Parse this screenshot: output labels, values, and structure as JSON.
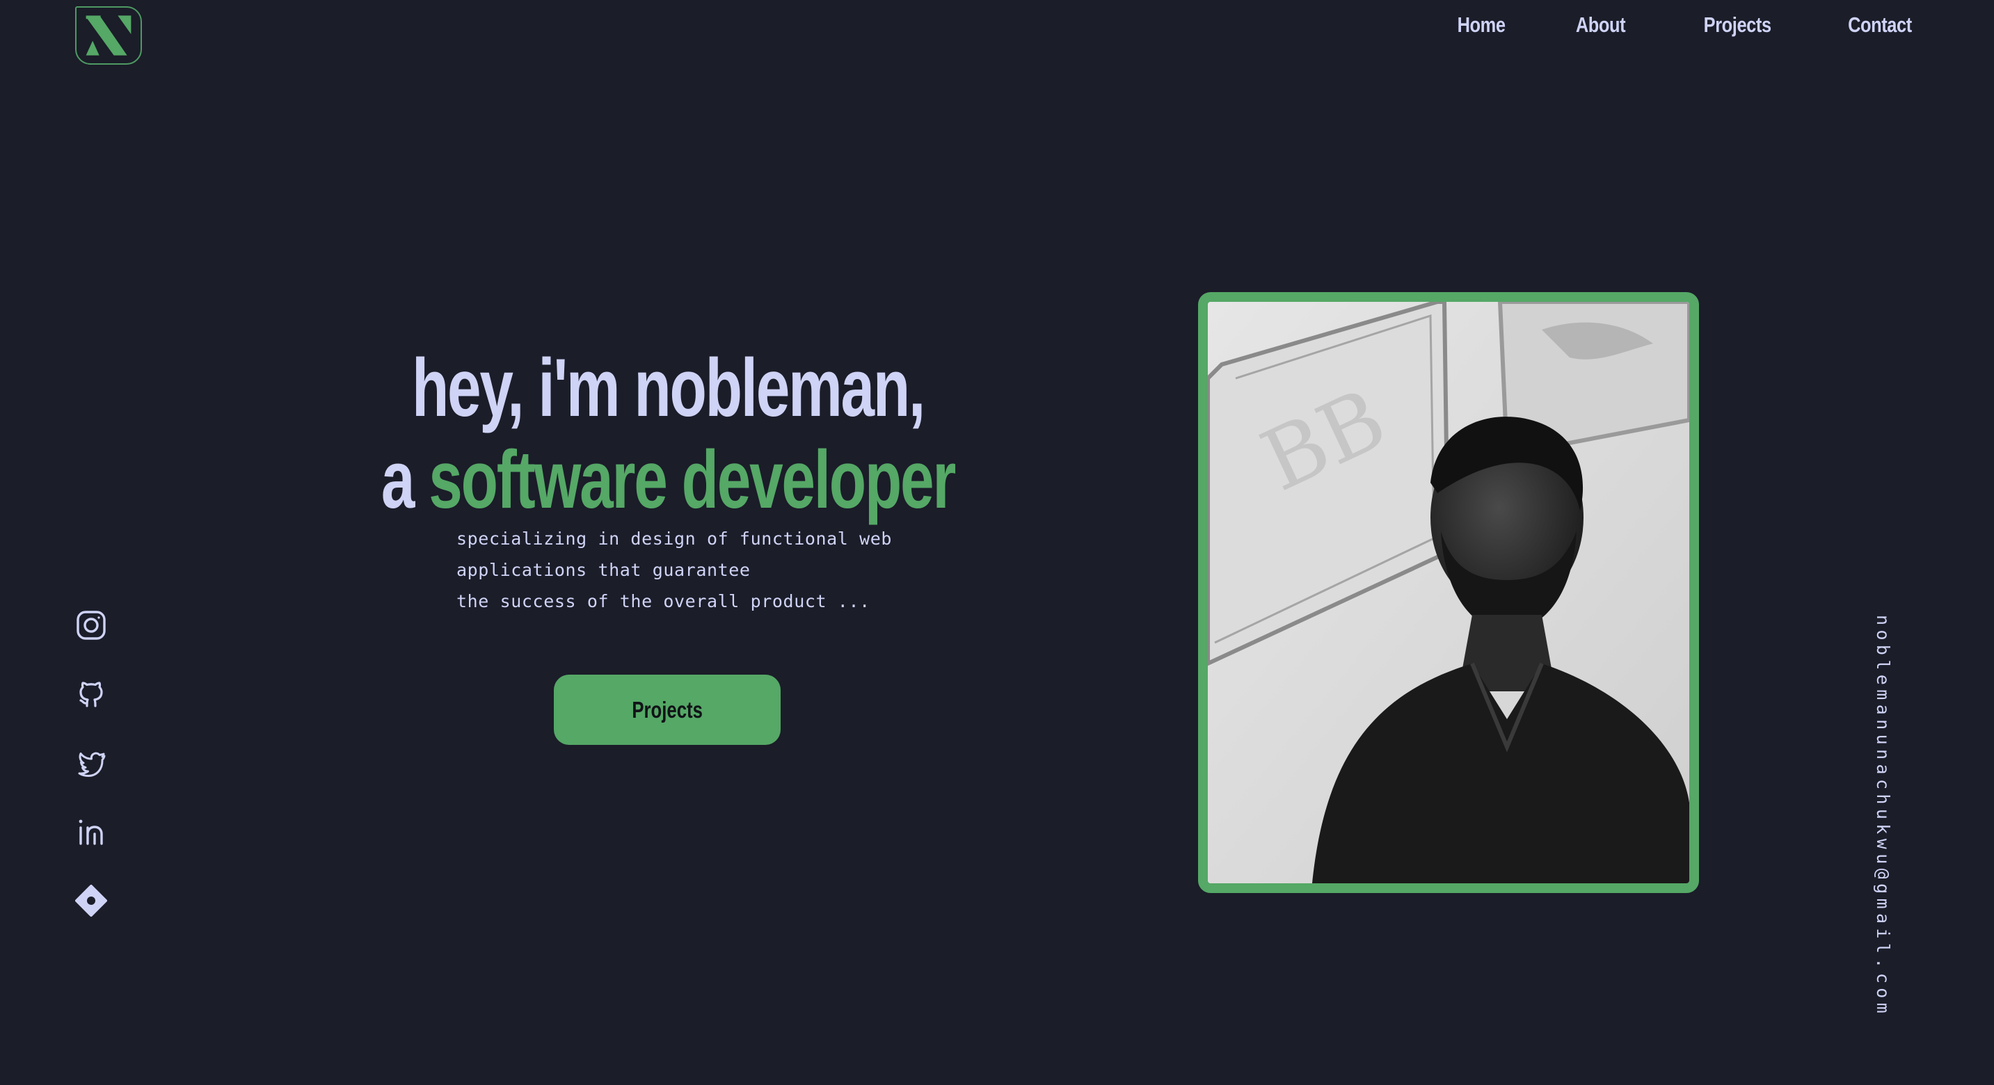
{
  "logo": {
    "letter": "N",
    "icon": "logo-n-icon",
    "color": "#55a866"
  },
  "nav": {
    "items": [
      {
        "label": "Home"
      },
      {
        "label": "About"
      },
      {
        "label": "Projects"
      },
      {
        "label": "Contact"
      }
    ]
  },
  "hero": {
    "line1": "hey, i'm nobleman,",
    "line2_prefix": "a ",
    "line2_accent": "software developer",
    "subtitle": "specializing in design of functional web\napplications that guarantee\nthe success of the overall product ...",
    "cta_label": "Projects"
  },
  "socials": [
    {
      "name": "instagram-icon"
    },
    {
      "name": "github-icon"
    },
    {
      "name": "twitter-icon"
    },
    {
      "name": "linkedin-icon"
    },
    {
      "name": "diamond-icon"
    }
  ],
  "photo": {
    "alt": "portrait photo"
  },
  "email": "noblemanunachukwu@gmail.com",
  "colors": {
    "background": "#1b1d29",
    "text": "#cfd3f5",
    "accent": "#55a866",
    "button_text": "#111317"
  }
}
